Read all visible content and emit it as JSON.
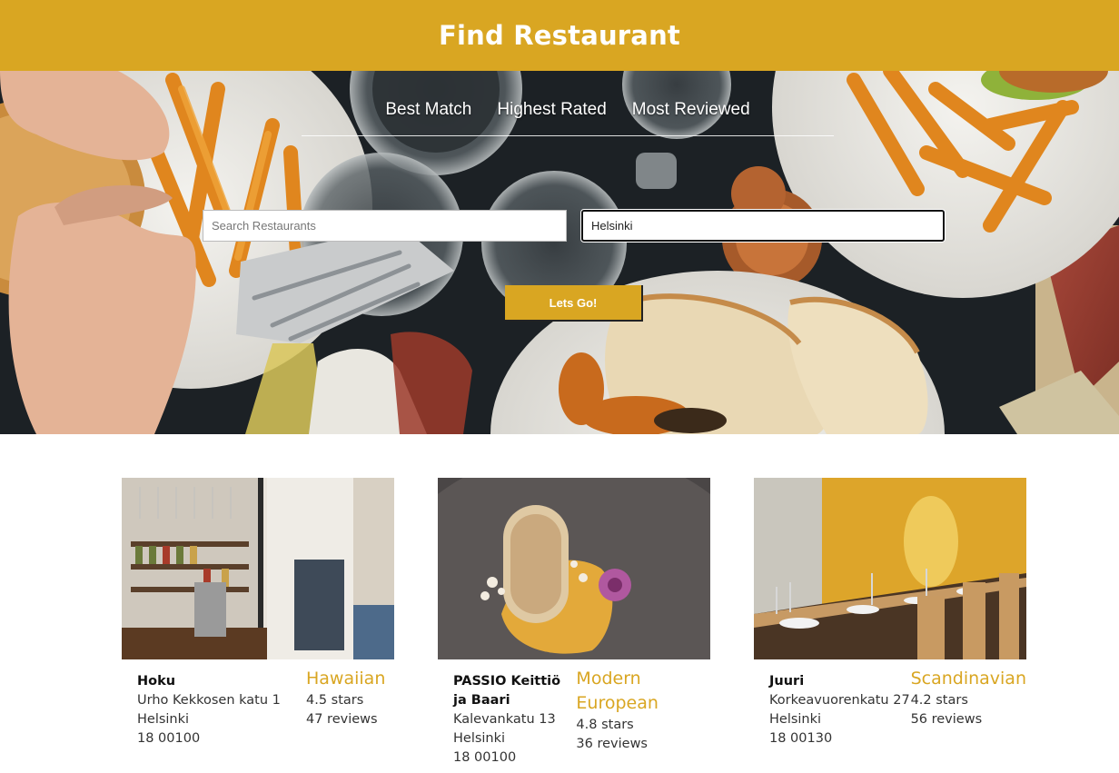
{
  "header": {
    "title": "Find Restaurant"
  },
  "sort_tabs": [
    "Best Match",
    "Highest Rated",
    "Most Reviewed"
  ],
  "search": {
    "term_placeholder": "Search Restaurants",
    "term_value": "",
    "location_value": "Helsinki",
    "submit_label": "Lets Go!"
  },
  "colors": {
    "brand": "#d9a622",
    "text": "#333333"
  },
  "restaurants": [
    {
      "name": "Hoku",
      "address": "Urho Kekkosen katu 1",
      "city": "Helsinki",
      "zip": "18 00100",
      "category": "Hawaiian",
      "rating": "4.5 stars",
      "reviews": "47 reviews"
    },
    {
      "name": "PASSIO Keittiö ja Baari",
      "address": "Kalevankatu 13",
      "city": "Helsinki",
      "zip": "18 00100",
      "category": "Modern European",
      "rating": "4.8 stars",
      "reviews": "36 reviews"
    },
    {
      "name": "Juuri",
      "address": "Korkeavuorenkatu 27",
      "city": "Helsinki",
      "zip": "18 00130",
      "category": "Scandinavian",
      "rating": "4.2 stars",
      "reviews": "56 reviews"
    }
  ]
}
